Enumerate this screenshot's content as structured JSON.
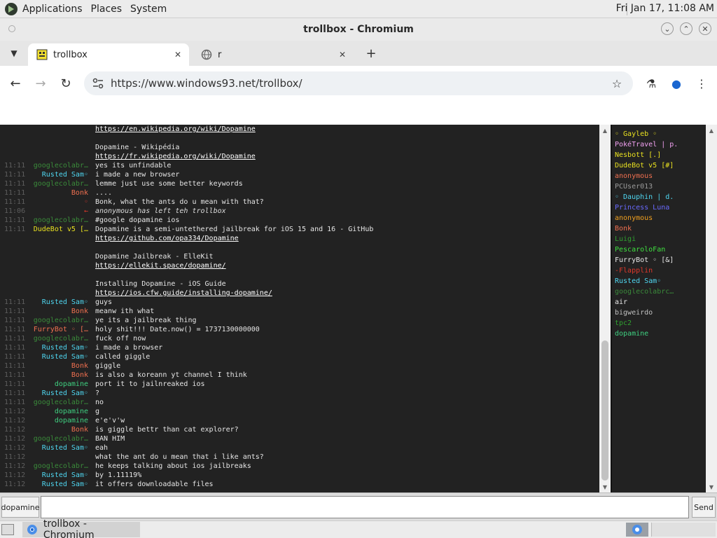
{
  "top_panel": {
    "menus": [
      "Applications",
      "Places",
      "System"
    ],
    "clock": "Fri Jan 17, 11:08 AM"
  },
  "window": {
    "title": "trollbox - Chromium"
  },
  "tabs": [
    {
      "label": "trollbox",
      "active": true
    },
    {
      "label": "r",
      "active": false
    }
  ],
  "toolbar": {
    "url": "https://www.windows93.net/trollbox/"
  },
  "chat": {
    "lines": [
      {
        "time": "",
        "user": "",
        "user_color": "#e6e6e6",
        "msg": "https://en.wikipedia.org/wiki/Dopamine",
        "style": "link"
      },
      {
        "time": "",
        "user": "",
        "user_color": "#e6e6e6",
        "msg": "",
        "style": ""
      },
      {
        "time": "",
        "user": "",
        "user_color": "#e6e6e6",
        "msg": "Dopamine - Wikipédia",
        "style": ""
      },
      {
        "time": "",
        "user": "",
        "user_color": "#e6e6e6",
        "msg": "https://fr.wikipedia.org/wiki/Dopamine",
        "style": "link"
      },
      {
        "time": "11:11",
        "user": "googlecolabr…",
        "user_color": "#3a8a3a",
        "msg": "yes its unfindable",
        "style": ""
      },
      {
        "time": "11:11",
        "user": "Rusted Sam◦",
        "user_color": "#4fd6f0",
        "msg": "i made a new browser",
        "style": ""
      },
      {
        "time": "11:11",
        "user": "googlecolabr…",
        "user_color": "#3a8a3a",
        "msg": "lemme just use some better keywords",
        "style": ""
      },
      {
        "time": "11:11",
        "user": "Bonk",
        "user_color": "#f07050",
        "msg": "....",
        "style": ""
      },
      {
        "time": "11:11",
        "user": "◦",
        "user_color": "#e0392b",
        "msg": "Bonk, what the ants do u mean with that?",
        "style": ""
      },
      {
        "time": "11:06",
        "user": "←",
        "user_color": "#e0392b",
        "msg": "anonymous has left teh trollbox",
        "style": "italic"
      },
      {
        "time": "11:11",
        "user": "googlecolabr…",
        "user_color": "#3a8a3a",
        "msg": "#google dopamine ios",
        "style": ""
      },
      {
        "time": "11:11",
        "user": "DudeBot v5 […",
        "user_color": "#e8e020",
        "msg": "Dopamine is a semi-untethered jailbreak for iOS 15 and 16 - GitHub",
        "style": ""
      },
      {
        "time": "",
        "user": "",
        "user_color": "#e6e6e6",
        "msg": "https://github.com/opa334/Dopamine",
        "style": "link"
      },
      {
        "time": "",
        "user": "",
        "user_color": "#e6e6e6",
        "msg": "",
        "style": ""
      },
      {
        "time": "",
        "user": "",
        "user_color": "#e6e6e6",
        "msg": "Dopamine Jailbreak - ElleKit",
        "style": ""
      },
      {
        "time": "",
        "user": "",
        "user_color": "#e6e6e6",
        "msg": "https://ellekit.space/dopamine/",
        "style": "link"
      },
      {
        "time": "",
        "user": "",
        "user_color": "#e6e6e6",
        "msg": "",
        "style": ""
      },
      {
        "time": "",
        "user": "",
        "user_color": "#e6e6e6",
        "msg": "Installing Dopamine - iOS Guide",
        "style": ""
      },
      {
        "time": "",
        "user": "",
        "user_color": "#e6e6e6",
        "msg": "https://ios.cfw.guide/installing-dopamine/",
        "style": "link"
      },
      {
        "time": "11:11",
        "user": "Rusted Sam◦",
        "user_color": "#4fd6f0",
        "msg": "guys",
        "style": ""
      },
      {
        "time": "11:11",
        "user": "Bonk",
        "user_color": "#f07050",
        "msg": "meanw ith what",
        "style": ""
      },
      {
        "time": "11:11",
        "user": "googlecolabr…",
        "user_color": "#3a8a3a",
        "msg": "ye its a jailbreak thing",
        "style": ""
      },
      {
        "time": "11:11",
        "user": "FurryBot ◦ […",
        "user_color": "#f07050",
        "msg": "holy shit!!! Date.now() = 1737130000000",
        "style": ""
      },
      {
        "time": "11:11",
        "user": "googlecolabr…",
        "user_color": "#3a8a3a",
        "msg": "fuck off now",
        "style": ""
      },
      {
        "time": "11:11",
        "user": "Rusted Sam◦",
        "user_color": "#4fd6f0",
        "msg": "i made a browser",
        "style": ""
      },
      {
        "time": "11:11",
        "user": "Rusted Sam◦",
        "user_color": "#4fd6f0",
        "msg": "called giggle",
        "style": ""
      },
      {
        "time": "11:11",
        "user": "Bonk",
        "user_color": "#f07050",
        "msg": "giggle",
        "style": ""
      },
      {
        "time": "11:11",
        "user": "Bonk",
        "user_color": "#f07050",
        "msg": "is also a koreann yt channel I think",
        "style": ""
      },
      {
        "time": "11:11",
        "user": "dopamine",
        "user_color": "#3fd080",
        "msg": "port it to jailnreaked ios",
        "style": ""
      },
      {
        "time": "11:11",
        "user": "Rusted Sam◦",
        "user_color": "#4fd6f0",
        "msg": "?",
        "style": ""
      },
      {
        "time": "11:11",
        "user": "googlecolabr…",
        "user_color": "#3a8a3a",
        "msg": "no",
        "style": ""
      },
      {
        "time": "11:12",
        "user": "dopamine",
        "user_color": "#3fd080",
        "msg": "g",
        "style": ""
      },
      {
        "time": "11:12",
        "user": "dopamine",
        "user_color": "#3fd080",
        "msg": "e'e'v'w",
        "style": ""
      },
      {
        "time": "11:12",
        "user": "Bonk",
        "user_color": "#f07050",
        "msg": "is giggle bettr than cat explorer?",
        "style": ""
      },
      {
        "time": "11:12",
        "user": "googlecolabr…",
        "user_color": "#3a8a3a",
        "msg": "BAN HIM",
        "style": ""
      },
      {
        "time": "11:12",
        "user": "Rusted Sam◦",
        "user_color": "#4fd6f0",
        "msg": "eah",
        "style": ""
      },
      {
        "time": "11:12",
        "user": "",
        "user_color": "#e6e6e6",
        "msg": "what the ant do u mean that i like ants?",
        "style": ""
      },
      {
        "time": "11:12",
        "user": "googlecolabr…",
        "user_color": "#3a8a3a",
        "msg": "he keeps talking about ios jailbreaks",
        "style": ""
      },
      {
        "time": "11:12",
        "user": "Rusted Sam◦",
        "user_color": "#4fd6f0",
        "msg": "by 1.11119%",
        "style": ""
      },
      {
        "time": "11:12",
        "user": "Rusted Sam◦",
        "user_color": "#4fd6f0",
        "msg": "it offers downloadable files",
        "style": ""
      }
    ]
  },
  "users": [
    {
      "name": "◦ Gayleb ◦",
      "color": "#e8e020"
    },
    {
      "name": "PokéTravel | p.",
      "color": "#f0a0f0"
    },
    {
      "name": "Nesbott [.]",
      "color": "#e8e020"
    },
    {
      "name": "DudeBot v5 [#]",
      "color": "#e8e020"
    },
    {
      "name": "anonymous",
      "color": "#f07050"
    },
    {
      "name": "PCUser013",
      "color": "#9a9a9a"
    },
    {
      "name": "◦ Dauphin | d.",
      "color": "#4fd6f0"
    },
    {
      "name": "Princess Luna",
      "color": "#6a6aff"
    },
    {
      "name": "anonymous",
      "color": "#f0a020"
    },
    {
      "name": "Bonk",
      "color": "#f07050"
    },
    {
      "name": "Luigi",
      "color": "#30a030"
    },
    {
      "name": "PescaroloFan",
      "color": "#3fe040"
    },
    {
      "name": "FurryBot ◦ [&]",
      "color": "#e6e6e6"
    },
    {
      "name": "-Flapplin",
      "color": "#e0392b"
    },
    {
      "name": "Rusted Sam◦",
      "color": "#4fd6f0"
    },
    {
      "name": "googlecolabrc…",
      "color": "#3a8a3a"
    },
    {
      "name": "air",
      "color": "#e6e6e6"
    },
    {
      "name": "bigweirdo",
      "color": "#c0c0c0"
    },
    {
      "name": "tpc2",
      "color": "#30a030"
    },
    {
      "name": "dopamine",
      "color": "#3fd080"
    }
  ],
  "input": {
    "nick": "dopamine",
    "value": "",
    "send_label": "Send"
  },
  "taskbar": {
    "task_label": "trollbox - Chromium"
  }
}
